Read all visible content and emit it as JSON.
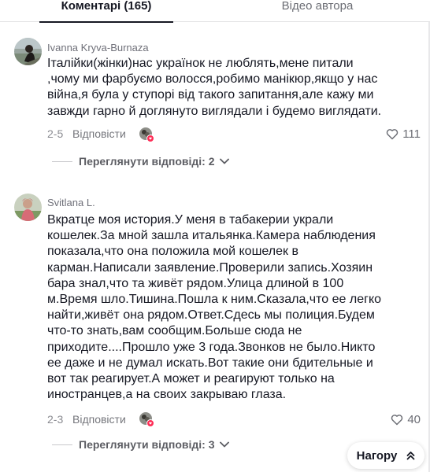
{
  "tabs": {
    "comments": "Коментарі (165)",
    "author_videos": "Відео автора"
  },
  "comments": [
    {
      "username": "Ivanna Kryva-Burnaza",
      "text": "Італійки(жінки)нас українок не люблять,мене питали ,чому ми фарбуємо волосся,робимо манікюр,якщо у нас війна,я була у ступорі від такого запитання,але кажу ми завжди гарно й доглянуто виглядали і будемо виглядати.",
      "date": "2-5",
      "reply_label": "Відповісти",
      "likes": "111",
      "view_replies": "Переглянути відповіді: 2"
    },
    {
      "username": "Svitlana L.",
      "text": "Вкратце моя история.У меня в табакерии украли кошелек.За мной зашла итальянка.Камера наблюдения показала,что она положила мой кошелек в карман.Написали заявление.Проверили запись.Хозяин бара знал,что та живёт рядом.Улица длиной в 100 м.Время шло.Тишина.Пошла к ним.Сказала,что ее легко найти,живёт она рядом.Ответ.Сдесь мы полиция.Будем что-то знать,вам сообщим.Больше сюда не приходите....Прошло уже 3 года.Звонков не было.Никто ее даже и не думал искать.Вот такие они бдительные и вот так реагирует.А может и реагируют только на иностранцев,а на своих закрываю глаза.",
      "date": "2-3",
      "reply_label": "Відповісти",
      "likes": "40",
      "view_replies": "Переглянути відповіді: 3"
    }
  ],
  "scroll_top": {
    "label": "Нагору"
  },
  "colors": {
    "text": "#161823",
    "muted": "#8a8b91",
    "creator_badge": "#fe2c55"
  },
  "icons": [
    "heart-icon",
    "chevron-down-icon",
    "double-chevron-up-icon",
    "avatar",
    "creator-liked-badge"
  ]
}
